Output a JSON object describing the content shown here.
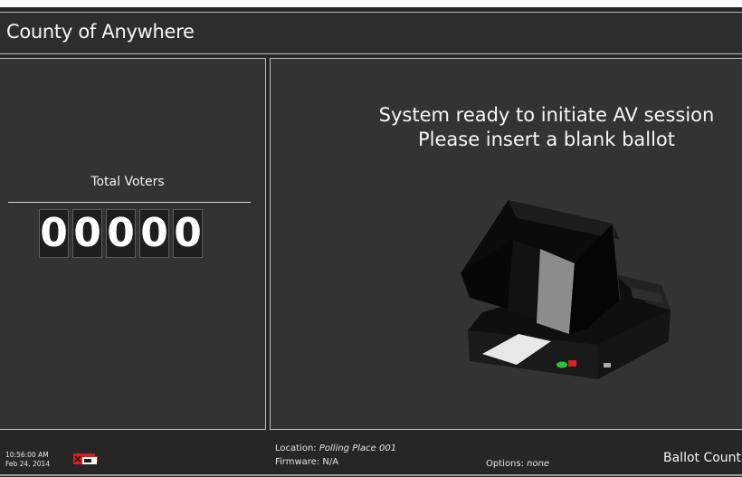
{
  "header": {
    "title": "County of Anywhere"
  },
  "voters": {
    "label": "Total Voters",
    "digits": [
      "0",
      "0",
      "0",
      "0",
      "0"
    ]
  },
  "status": {
    "line1": "System ready to initiate AV session",
    "line2": "Please insert a blank ballot"
  },
  "footer": {
    "time": "10:56:00 AM",
    "date": "Feb 24, 2014",
    "battery_icon": "battery-unplugged-icon",
    "location_label": "Location:",
    "location_value": "Polling Place 001",
    "firmware_label": "Firmware:",
    "firmware_value": "N/A",
    "options_label": "Options:",
    "options_value": "none",
    "ballot_count_label": "Ballot Count"
  },
  "colors": {
    "background": "#262626",
    "panel": "#333333",
    "border": "#bdbdbd",
    "text": "#f2f2f2",
    "battery_alert": "#d32020"
  }
}
